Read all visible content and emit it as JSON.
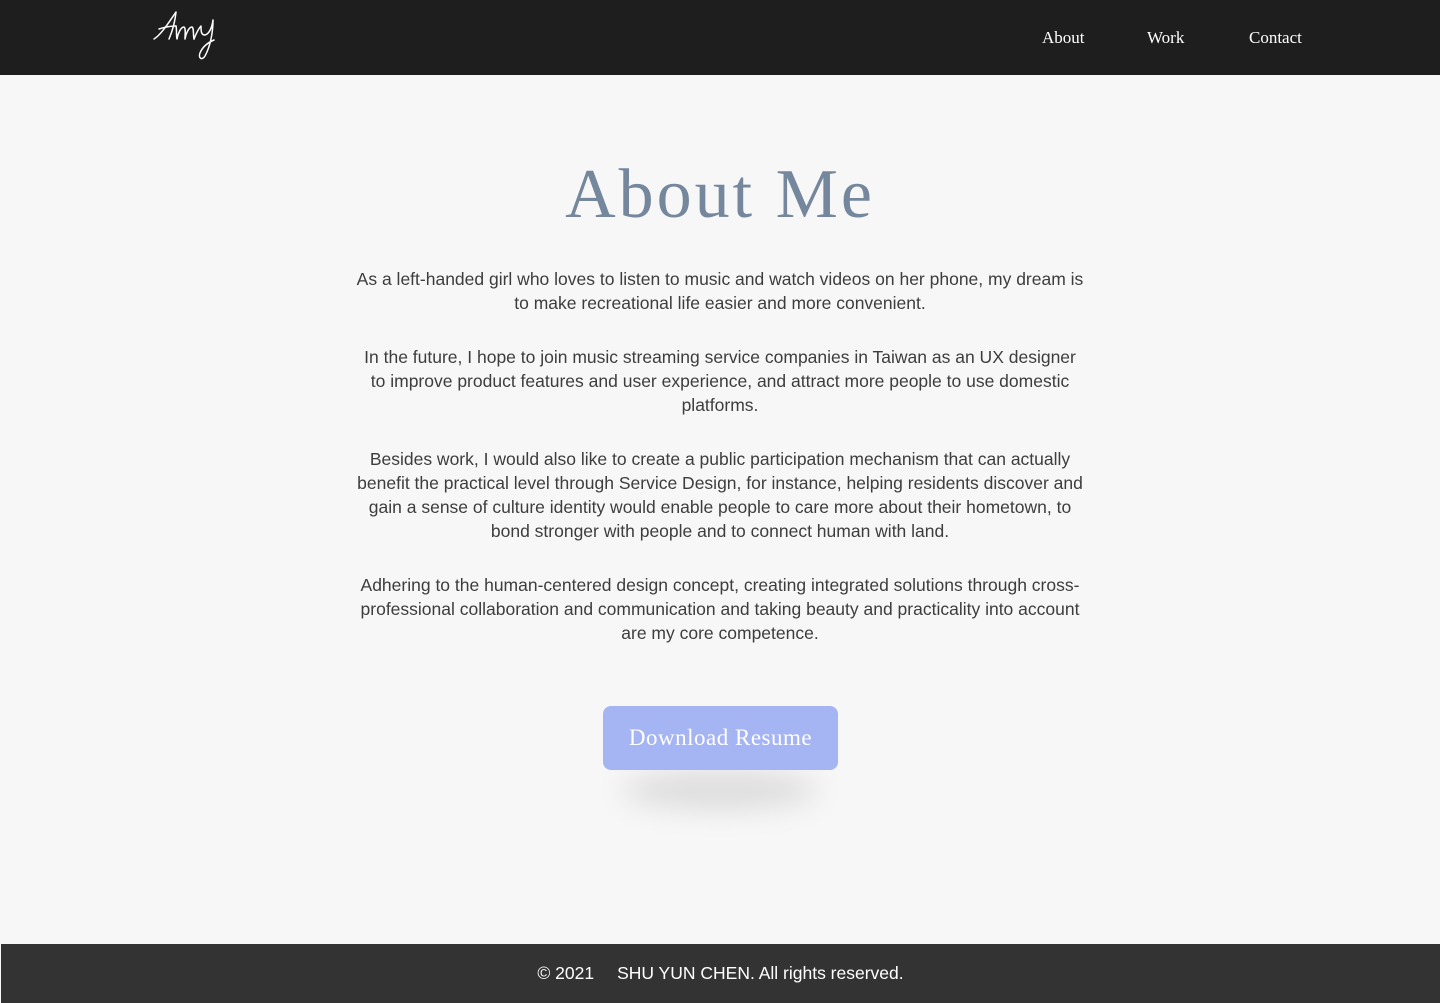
{
  "header": {
    "logo_text": "Amy",
    "nav": [
      {
        "label": "About"
      },
      {
        "label": "Work"
      },
      {
        "label": "Contact"
      }
    ]
  },
  "main": {
    "title": "About Me",
    "paragraphs": [
      "As a left-handed girl who loves to listen to music and watch videos on her phone, my dream is to make recreational life easier and more convenient.",
      "In the future, I hope to join music streaming service companies in Taiwan as an UX designer to improve product features and user experience, and attract more people to use domestic platforms.",
      "Besides work, I would also like to create a public participation mechanism that can actually benefit the practical level through Service Design, for instance, helping residents discover and gain a sense of culture identity would enable people to care more about their hometown, to bond stronger with people and to connect human with land.",
      "Adhering to the human-centered design concept, creating integrated solutions through cross-professional collaboration and communication and taking beauty and practicality into account are my core competence."
    ],
    "resume_button_label": "Download Resume"
  },
  "footer": {
    "copyright": "© 2021",
    "owner": "SHU YUN CHEN. All rights reserved."
  },
  "colors": {
    "header_bg": "#1e1e1e",
    "page_bg": "#f7f7f7",
    "title": "#74879c",
    "button": "#a5b4f2",
    "footer_bg": "#333333"
  }
}
